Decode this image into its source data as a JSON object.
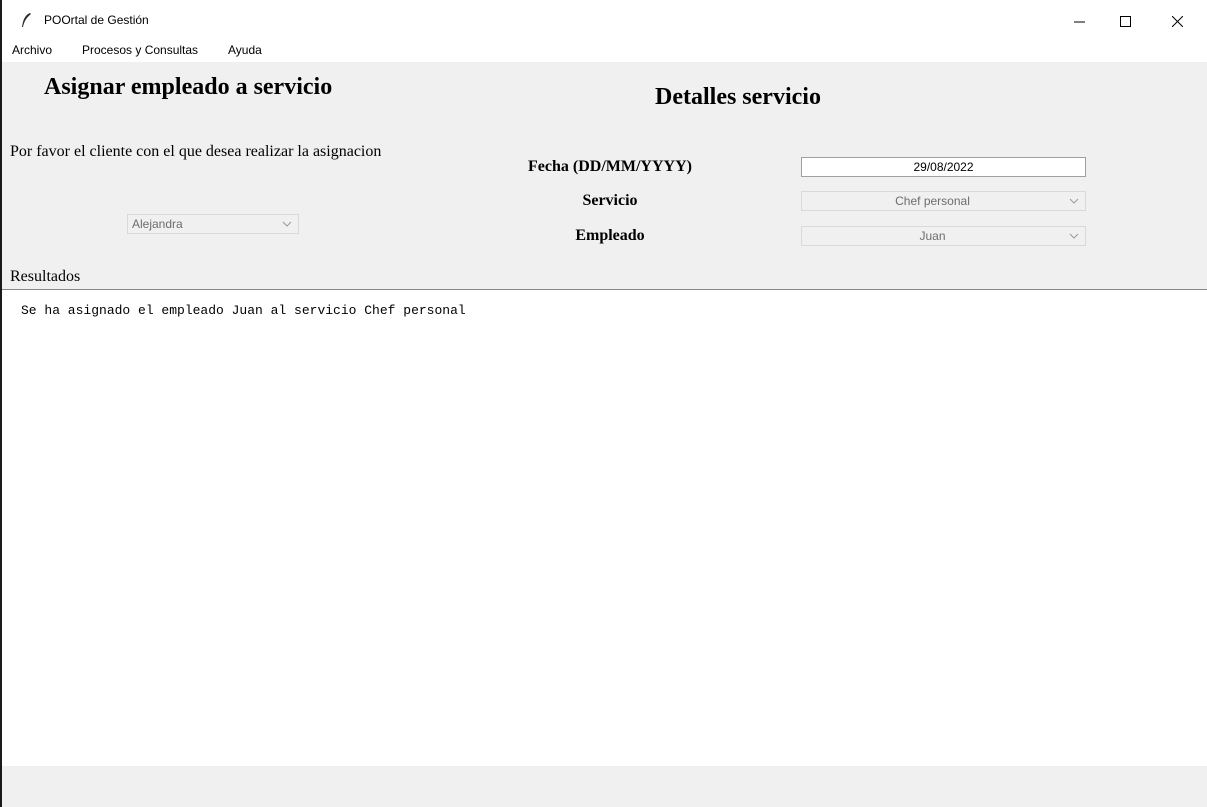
{
  "window": {
    "title": "POOrtal de Gestión"
  },
  "menu": {
    "items": [
      "Archivo",
      "Procesos y Consultas",
      "Ayuda"
    ]
  },
  "left_panel": {
    "heading": "Asignar empleado a servicio",
    "prompt": "Por favor el cliente con el que desea realizar la asignacion",
    "client_combo": {
      "value": "Alejandra"
    }
  },
  "right_panel": {
    "heading": "Detalles servicio",
    "date_label": "Fecha (DD/MM/YYYY)",
    "date_value": "29/08/2022",
    "service_label": "Servicio",
    "service_value": "Chef personal",
    "employee_label": "Empleado",
    "employee_value": "Juan"
  },
  "results": {
    "label": "Resultados",
    "text": "Se ha asignado el empleado Juan al servicio Chef personal"
  },
  "icons": [
    "feather-app-icon",
    "minimize-icon",
    "maximize-icon",
    "close-icon",
    "chevron-down-icon"
  ]
}
